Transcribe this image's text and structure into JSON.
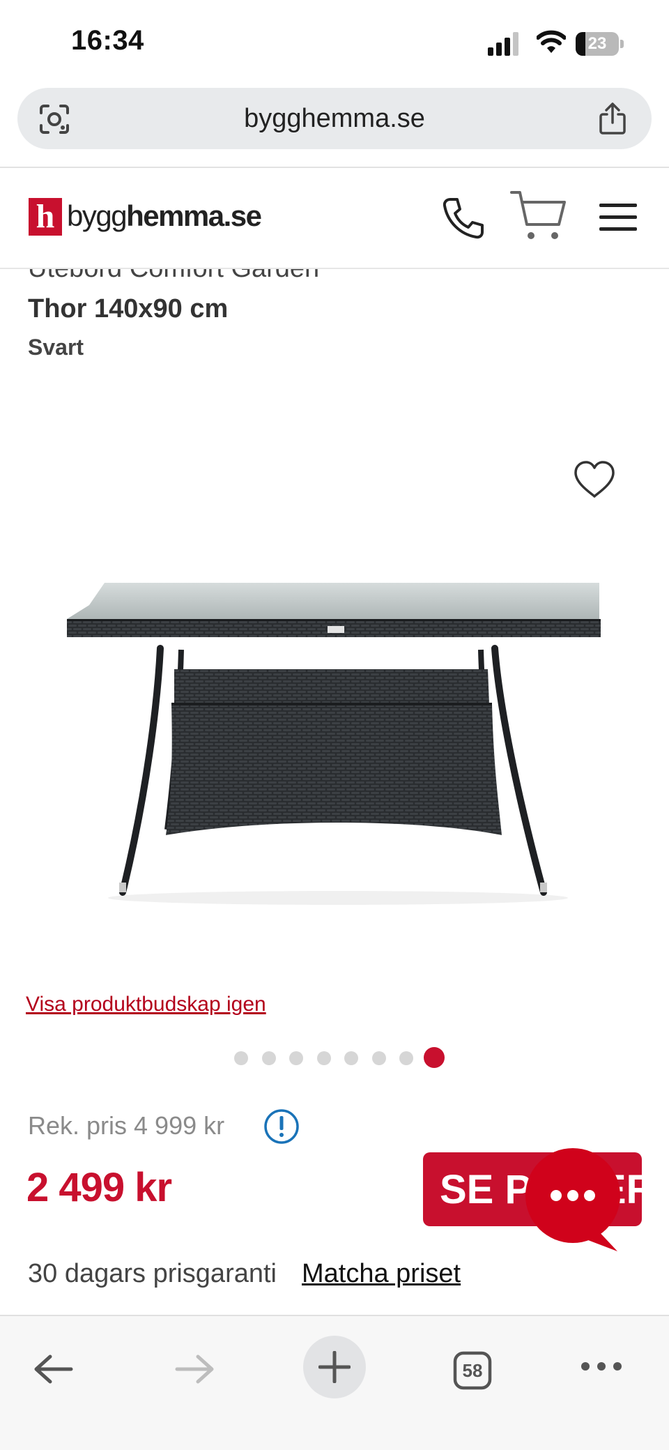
{
  "status_bar": {
    "time": "16:34",
    "battery": "23",
    "battery_level": 0.23,
    "icons": [
      "signal-icon",
      "wifi-icon",
      "battery-icon"
    ]
  },
  "browser": {
    "url": "bygghemma.se",
    "icons": [
      "lens-icon",
      "share-icon"
    ]
  },
  "site_header": {
    "logo_mark": "h",
    "logo_prefix": "bygg",
    "logo_bold": "hemma",
    "logo_suffix": ".se",
    "icons": [
      "phone-icon",
      "cart-icon",
      "menu-icon"
    ]
  },
  "product": {
    "series_title": "Utebord Comfort Garden",
    "name": "Thor 140x90 cm",
    "color": "Svart",
    "image_alt": "Black rattan outdoor table with glass top",
    "favorite_icon": "heart-icon"
  },
  "promo_link": "Visa produktbudskap igen",
  "carousel": {
    "count": 8,
    "active_index": 7
  },
  "pricing": {
    "rek_price": "Rek. pris 4 999 kr",
    "price": "2 499 kr",
    "cta_label": "SE PRISER",
    "guarantee_text": "30 dagars prisgaranti",
    "match_link": "Matcha priset",
    "colors": {
      "brand_red": "#c8102e",
      "link_red": "#b3001b",
      "info_blue": "#1a73b8"
    }
  },
  "chat": {
    "label": "•••"
  },
  "toolbar": {
    "tabs_count": "58",
    "icons": [
      "back-arrow-icon",
      "forward-arrow-icon",
      "plus-icon",
      "tabs-icon",
      "more-icon"
    ]
  }
}
